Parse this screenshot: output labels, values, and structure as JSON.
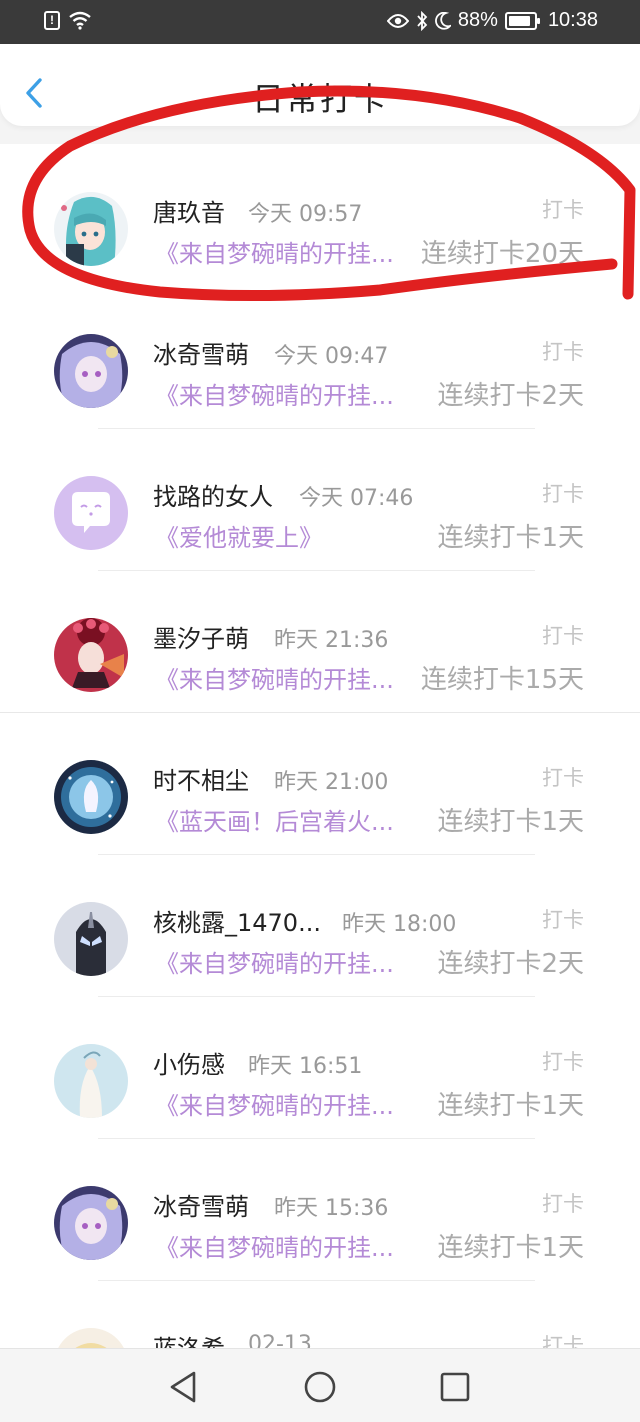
{
  "status_bar": {
    "battery_percent": "88%",
    "battery_level": 0.88,
    "time": "10:38",
    "alert_glyph": "!"
  },
  "header": {
    "title": "日常打卡"
  },
  "entries": [
    {
      "name": "唐玖音",
      "time": "今天 09:57",
      "tag": "打卡",
      "book": "《来自梦碗晴的开挂...",
      "streak": "连续打卡20天",
      "avatar": "avatar-anime-teal-hair"
    },
    {
      "name": "冰奇雪萌",
      "time": "今天 09:47",
      "tag": "打卡",
      "book": "《来自梦碗晴的开挂...",
      "streak": "连续打卡2天",
      "avatar": "avatar-anime-lilac-hair"
    },
    {
      "name": "找路的女人",
      "time": "今天 07:46",
      "tag": "打卡",
      "book": "《爱他就要上》",
      "streak": "连续打卡1天",
      "avatar": "avatar-chat-bubble"
    },
    {
      "name": "墨汐子萌",
      "time": "昨天 21:36",
      "tag": "打卡",
      "book": "《来自梦碗晴的开挂...",
      "streak": "连续打卡15天",
      "avatar": "avatar-red-headdress"
    },
    {
      "name": "时不相尘",
      "time": "昨天 21:00",
      "tag": "打卡",
      "book": "《蓝天画！后宫着火...",
      "streak": "连续打卡1天",
      "avatar": "avatar-starry-blue"
    },
    {
      "name": "核桃露_1470...",
      "time": "昨天 18:00",
      "tag": "打卡",
      "book": "《来自梦碗晴的开挂...",
      "streak": "连续打卡2天",
      "avatar": "avatar-dark-hero"
    },
    {
      "name": "小伤感",
      "time": "昨天 16:51",
      "tag": "打卡",
      "book": "《来自梦碗晴的开挂...",
      "streak": "连续打卡1天",
      "avatar": "avatar-pale-figure"
    },
    {
      "name": "冰奇雪萌",
      "time": "昨天 15:36",
      "tag": "打卡",
      "book": "《来自梦碗晴的开挂...",
      "streak": "连续打卡1天",
      "avatar": "avatar-anime-lilac-hair"
    },
    {
      "name": "蓝洛希",
      "time": "02-13",
      "tag": "打卡",
      "book": "",
      "streak": "",
      "avatar": "avatar-blonde"
    }
  ],
  "colors": {
    "book_title": "#b48ad6",
    "annotation": "#e02020",
    "back_arrow": "#3da0e6"
  },
  "nav": {
    "back_icon": "triangle-back-icon",
    "home_icon": "circle-home-icon",
    "recents_icon": "square-recents-icon"
  }
}
